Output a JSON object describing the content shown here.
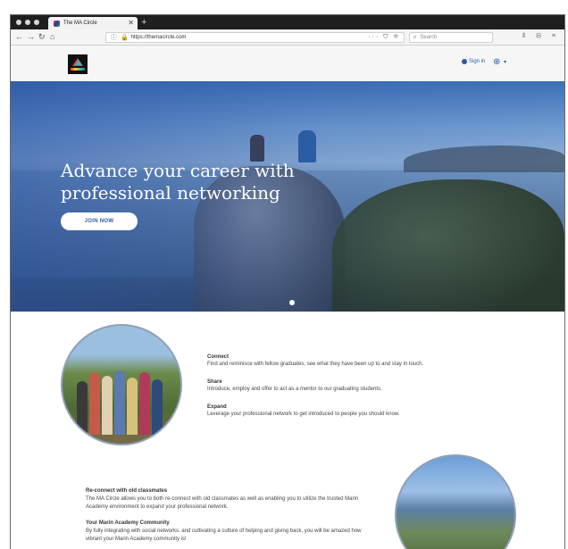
{
  "browser": {
    "tab_title": "The MA Circle",
    "url": "https://themacircle.com",
    "search_placeholder": "Search",
    "url_tools": "··· ⛉ ☆",
    "right_tools": "⫴ ⊟ ≡"
  },
  "header": {
    "signin_label": "Sign in"
  },
  "hero": {
    "title": "Advance your career with professional networking",
    "join_label": "JOIN NOW"
  },
  "features": [
    {
      "heading": "Connect",
      "text": "Find and reminisce with fellow graduates, see what they have been up to and stay in touch."
    },
    {
      "heading": "Share",
      "text": "Introduce, employ and offer to act as a mentor to our graduating students."
    },
    {
      "heading": "Expand",
      "text": "Leverage your professional network to get introduced to people you should know."
    }
  ],
  "blocks": [
    {
      "heading": "Re-connect with old classmates",
      "text": "The MA Circle allows you to both re-connect with old classmates as well as enabling you to utilize the trusted Marin Academy environment to expand your professional network."
    },
    {
      "heading": "Your Marin Academy Community",
      "text": "By fully integrating with social networks, and cultivating a culture of helping and giving back, you will be amazed how vibrant your Marin Academy community is!"
    }
  ],
  "colors": {
    "accent": "#2c5aa0",
    "hero_blue": "#3d6fb5"
  }
}
